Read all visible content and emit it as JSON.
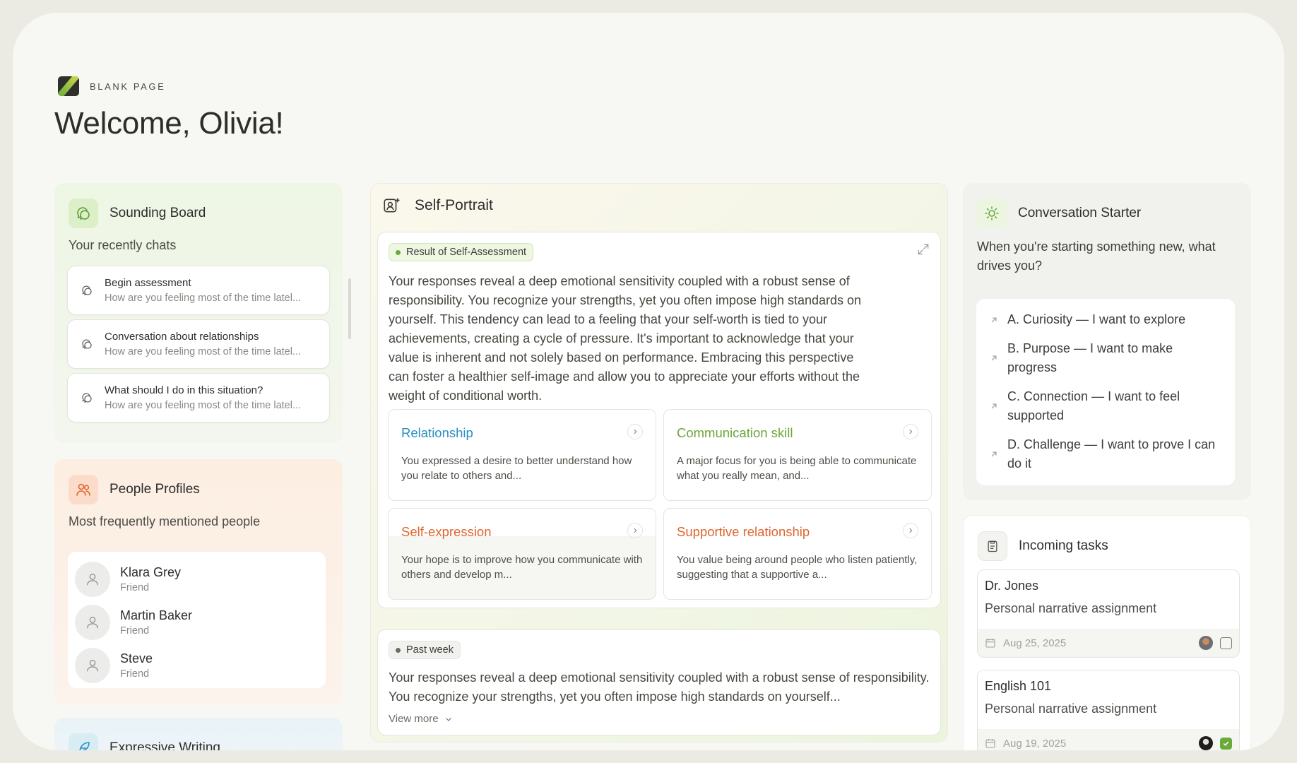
{
  "brand": {
    "name": "BLANK PAGE"
  },
  "welcome": "Welcome, Olivia!",
  "sounding_board": {
    "title": "Sounding Board",
    "subtitle": "Your recently chats",
    "chats": [
      {
        "title": "Begin assessment",
        "preview": "How are you feeling most of the time latel..."
      },
      {
        "title": "Conversation about relationships",
        "preview": "How are you feeling most of the time latel..."
      },
      {
        "title": "What should I do in this situation?",
        "preview": "How are you feeling most of the time latel..."
      }
    ]
  },
  "people_profiles": {
    "title": "People Profiles",
    "subtitle": "Most frequently mentioned people",
    "people": [
      {
        "name": "Klara Grey",
        "role": "Friend"
      },
      {
        "name": "Martin Baker",
        "role": "Friend"
      },
      {
        "name": "Steve",
        "role": "Friend"
      }
    ]
  },
  "expressive_writing": {
    "title": "Expressive Writing"
  },
  "self_portrait": {
    "title": "Self-Portrait",
    "result_tag": "Result of Self-Assessment",
    "result_text": "Your responses reveal a deep emotional sensitivity coupled with a robust sense of responsibility. You recognize your strengths, yet you often impose high standards on yourself. This tendency can lead to a feeling that your self-worth is tied to your achievements, creating a cycle of pressure. It's important to acknowledge that your value is inherent and not solely based on performance. Embracing this perspective can foster a healthier self-image and allow you to appreciate your efforts without the weight of conditional worth.",
    "categories": [
      {
        "title": "Relationship",
        "desc": "You expressed a desire to better understand how you relate to others and...",
        "color": "#2b8fc3"
      },
      {
        "title": "Communication skill",
        "desc": "A major focus for you is being able to communicate what you really mean, and...",
        "color": "#6aa63a"
      },
      {
        "title": "Self-expression",
        "desc": "Your hope is to improve how you communicate with others and develop m...",
        "color": "#e0662f"
      },
      {
        "title": "Supportive relationship",
        "desc": "You value being around people who listen patiently, suggesting that a supportive a...",
        "color": "#e0662f"
      }
    ],
    "week_tag": "Past week",
    "week_text": "Your responses reveal a deep emotional sensitivity coupled with a robust sense of responsibility. You recognize your strengths, yet you often impose high standards on yourself...",
    "view_more": "View more"
  },
  "conversation_starter": {
    "title": "Conversation Starter",
    "question": "When you're starting something new, what drives you?",
    "options": [
      "A. Curiosity — I want to explore",
      "B. Purpose — I want to make progress",
      "C. Connection — I want to feel supported",
      "D. Challenge — I want to prove I can do it"
    ]
  },
  "incoming_tasks": {
    "title": "Incoming tasks",
    "tasks": [
      {
        "name": "Dr. Jones",
        "desc": "Personal narrative assignment",
        "date": "Aug 25, 2025",
        "done": false
      },
      {
        "name": "English 101",
        "desc": "Personal narrative assignment",
        "date": "Aug 19, 2025",
        "done": true
      }
    ]
  },
  "colors": {
    "accent_green": "#6aa63a",
    "accent_blue": "#2b8fc3",
    "accent_orange": "#e0662f"
  }
}
